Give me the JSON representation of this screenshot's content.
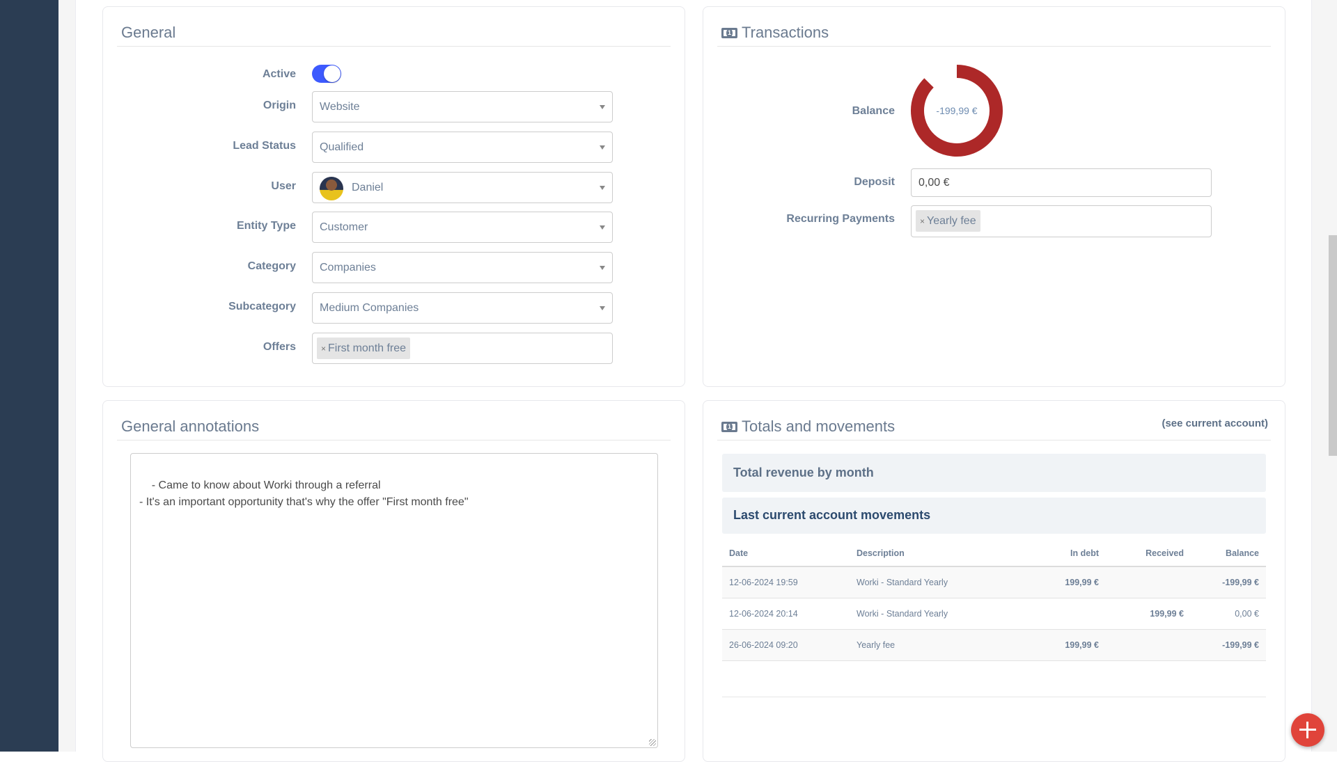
{
  "general": {
    "title": "General",
    "active_label": "Active",
    "active": true,
    "fields": [
      {
        "label": "Origin",
        "value": "Website",
        "type": "select"
      },
      {
        "label": "Lead Status",
        "value": "Qualified",
        "type": "select"
      },
      {
        "label": "User",
        "value": "Daniel",
        "type": "select",
        "avatar": true
      },
      {
        "label": "Entity Type",
        "value": "Customer",
        "type": "select"
      },
      {
        "label": "Category",
        "value": "Companies",
        "type": "select"
      },
      {
        "label": "Subcategory",
        "value": "Medium Companies",
        "type": "select"
      },
      {
        "label": "Offers",
        "value": "First month free",
        "type": "tags"
      }
    ]
  },
  "transactions": {
    "title": "Transactions",
    "icon": "money-bill-icon",
    "balance_label": "Balance",
    "balance_value": "-199,99 €",
    "balance_ring_fill": 0.875,
    "balance_color": "#ad2828",
    "deposit_label": "Deposit",
    "deposit_value": "0,00 €",
    "recurring_label": "Recurring Payments",
    "recurring_tag": "Yearly fee",
    "tag_remove": "×"
  },
  "annotations": {
    "title": "General annotations",
    "text": "- Came to know about Worki through a referral\n- It's an important opportunity that's why the offer \"First month free\""
  },
  "totals": {
    "title": "Totals and movements",
    "icon": "money-bill-icon",
    "see_account_link": "(see current account)",
    "revenue_panel": "Total revenue by month",
    "movements_panel": "Last current account movements",
    "columns": [
      "Date",
      "Description",
      "In debt",
      "Received",
      "Balance"
    ],
    "rows": [
      {
        "date": "12-06-2024 19:59",
        "description": "Worki - Standard Yearly",
        "in_debt": "199,99 €",
        "received": "",
        "balance": "-199,99 €",
        "balance_negative": true
      },
      {
        "date": "12-06-2024 20:14",
        "description": "Worki - Standard Yearly",
        "in_debt": "",
        "received": "199,99 €",
        "balance": "0,00 €",
        "balance_negative": false
      },
      {
        "date": "26-06-2024 09:20",
        "description": "Yearly fee",
        "in_debt": "199,99 €",
        "received": "",
        "balance": "-199,99 €",
        "balance_negative": true
      }
    ]
  },
  "fab": {
    "icon": "plus-icon"
  }
}
